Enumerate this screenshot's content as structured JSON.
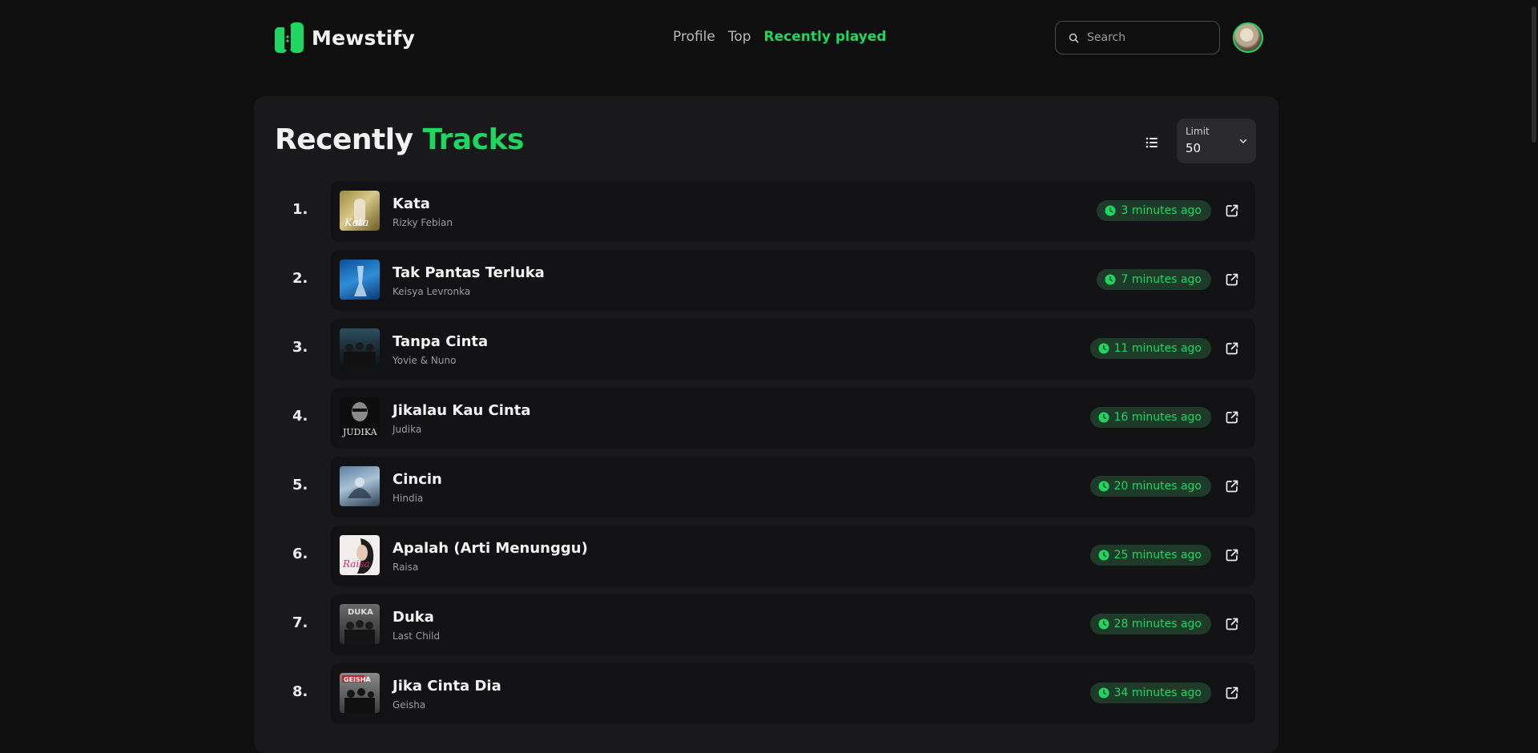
{
  "brand": {
    "name": "Mewstify",
    "accent": "#1ed760"
  },
  "nav": [
    {
      "label": "Profile",
      "active": false
    },
    {
      "label": "Top",
      "active": false
    },
    {
      "label": "Recently played",
      "active": true
    }
  ],
  "search": {
    "placeholder": "Search"
  },
  "title": {
    "part1": "Recently ",
    "part2": "Tracks"
  },
  "limit": {
    "label": "Limit",
    "value": "50"
  },
  "tracks": [
    {
      "rank": "1.",
      "title": "Kata",
      "artist": "Rizky Febian",
      "time": "3 minutes ago"
    },
    {
      "rank": "2.",
      "title": "Tak Pantas Terluka",
      "artist": "Keisya Levronka",
      "time": "7 minutes ago"
    },
    {
      "rank": "3.",
      "title": "Tanpa Cinta",
      "artist": "Yovie & Nuno",
      "time": "11 minutes ago"
    },
    {
      "rank": "4.",
      "title": "Jikalau Kau Cinta",
      "artist": "Judika",
      "time": "16 minutes ago"
    },
    {
      "rank": "5.",
      "title": "Cincin",
      "artist": "Hindia",
      "time": "20 minutes ago"
    },
    {
      "rank": "6.",
      "title": "Apalah (Arti Menunggu)",
      "artist": "Raisa",
      "time": "25 minutes ago"
    },
    {
      "rank": "7.",
      "title": "Duka",
      "artist": "Last Child",
      "time": "28 minutes ago"
    },
    {
      "rank": "8.",
      "title": "Jika Cinta Dia",
      "artist": "Geisha",
      "time": "34 minutes ago"
    }
  ],
  "icons": {
    "search": "search-icon",
    "list_view": "list-view-icon",
    "chevron": "chevron-down-icon",
    "clock": "clock-icon",
    "external": "external-link-icon"
  }
}
